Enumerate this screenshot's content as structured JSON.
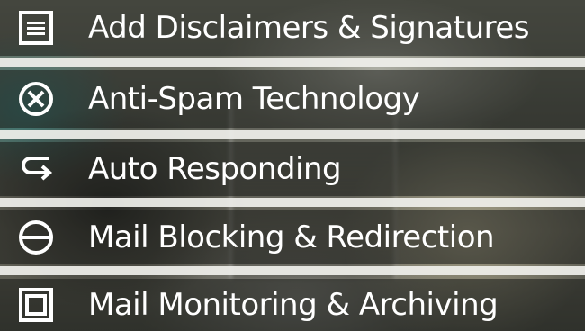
{
  "features": [
    {
      "label": "Add Disclaimers & Signatures",
      "icon": "document-lines-icon"
    },
    {
      "label": "Anti-Spam Technology",
      "icon": "circle-x-icon"
    },
    {
      "label": "Auto Responding",
      "icon": "return-arrow-icon"
    },
    {
      "label": "Mail Blocking & Redirection",
      "icon": "circle-minus-icon"
    },
    {
      "label": "Mail Monitoring & Archiving",
      "icon": "framed-square-icon"
    }
  ],
  "colors": {
    "text": "#ffffff",
    "row_overlay": "#181a16",
    "separator": "#f0f0eb"
  }
}
